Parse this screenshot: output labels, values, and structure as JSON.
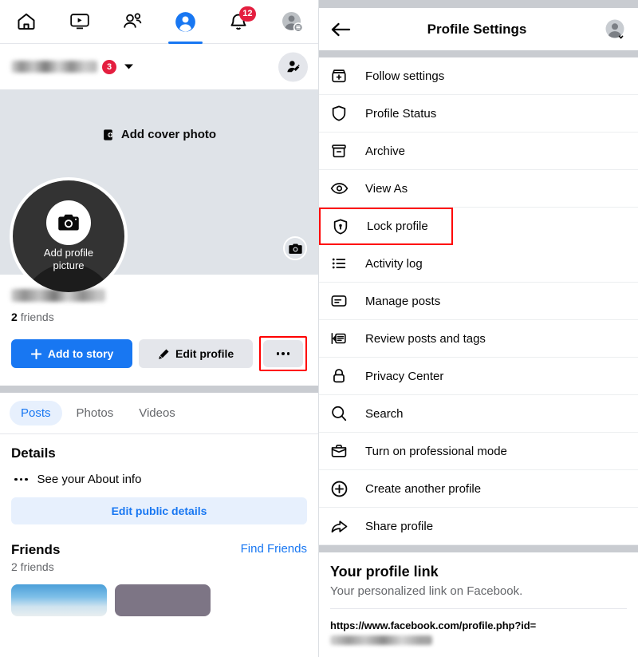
{
  "left": {
    "topnav": [
      {
        "name": "home",
        "icon": "home-icon",
        "active": false,
        "badge": ""
      },
      {
        "name": "video",
        "icon": "video-icon",
        "active": false,
        "badge": ""
      },
      {
        "name": "friends",
        "icon": "friends-icon",
        "active": false,
        "badge": ""
      },
      {
        "name": "profile",
        "icon": "profile-icon",
        "active": true,
        "badge": ""
      },
      {
        "name": "notifications",
        "icon": "bell-icon",
        "active": false,
        "badge": "12"
      },
      {
        "name": "menu",
        "icon": "account-menu-icon",
        "active": false,
        "badge": ""
      }
    ],
    "account_badge": "3",
    "cover": {
      "add_cover_label": "Add cover photo",
      "camera_icon": "camera-icon",
      "cover_bg_color": "#dfe3e8"
    },
    "avatar": {
      "add_profile_label_line1": "Add profile",
      "add_profile_label_line2": "picture",
      "camera_icon": "camera-icon"
    },
    "identity": {
      "friends_count": "2",
      "friends_word": "friends"
    },
    "buttons": {
      "add_to_story": "Add to story",
      "edit_profile": "Edit profile",
      "more_options": "···",
      "primary_color": "#1877f2",
      "highlight_color": "#ff0000"
    },
    "tabs": [
      {
        "label": "Posts",
        "active": true
      },
      {
        "label": "Photos",
        "active": false
      },
      {
        "label": "Videos",
        "active": false
      }
    ],
    "details": {
      "title": "Details",
      "about_row": "See your About info",
      "edit_public_details": "Edit public details"
    },
    "friends_section": {
      "title": "Friends",
      "subtitle": "2 friends",
      "find_friends": "Find Friends"
    }
  },
  "right": {
    "header": {
      "back_icon": "back-arrow-icon",
      "title": "Profile Settings",
      "avatar_icon": "avatar-chevron-icon"
    },
    "menu": [
      {
        "label": "Follow settings",
        "icon": "follow-settings-icon",
        "highlighted": false
      },
      {
        "label": "Profile Status",
        "icon": "shield-icon",
        "highlighted": false
      },
      {
        "label": "Archive",
        "icon": "archive-icon",
        "highlighted": false
      },
      {
        "label": "View As",
        "icon": "eye-icon",
        "highlighted": false
      },
      {
        "label": "Lock profile",
        "icon": "shield-lock-icon",
        "highlighted": true
      },
      {
        "label": "Activity log",
        "icon": "list-icon",
        "highlighted": false
      },
      {
        "label": "Manage posts",
        "icon": "manage-posts-icon",
        "highlighted": false
      },
      {
        "label": "Review posts and tags",
        "icon": "review-posts-icon",
        "highlighted": false
      },
      {
        "label": "Privacy Center",
        "icon": "padlock-icon",
        "highlighted": false
      },
      {
        "label": "Search",
        "icon": "search-icon",
        "highlighted": false
      },
      {
        "label": "Turn on professional mode",
        "icon": "briefcase-icon",
        "highlighted": false
      },
      {
        "label": "Create another profile",
        "icon": "plus-circle-icon",
        "highlighted": false
      },
      {
        "label": "Share profile",
        "icon": "share-arrow-icon",
        "highlighted": false
      }
    ],
    "profile_link": {
      "title": "Your profile link",
      "subtitle": "Your personalized link on Facebook.",
      "url": "https://www.facebook.com/profile.php?id="
    }
  }
}
